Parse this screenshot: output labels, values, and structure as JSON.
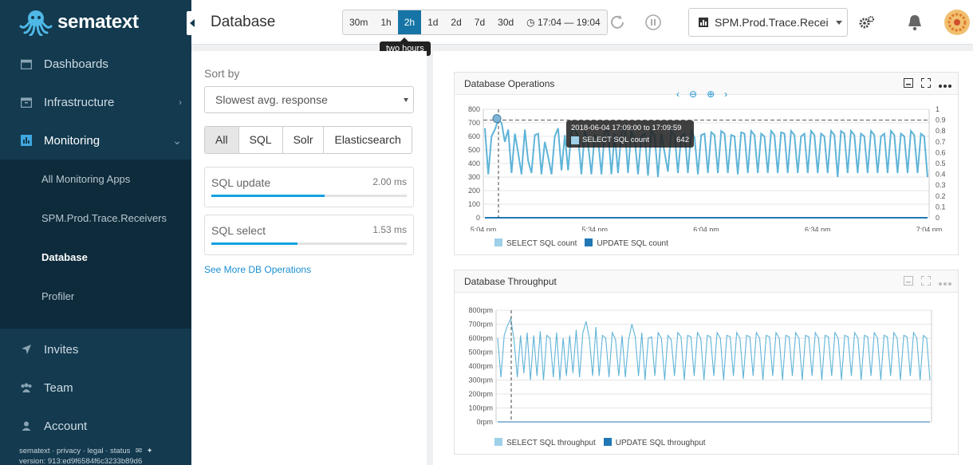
{
  "brand": {
    "name": "sematext"
  },
  "sidebar": {
    "items": [
      {
        "label": "Dashboards",
        "icon": "calendar-icon"
      },
      {
        "label": "Infrastructure",
        "icon": "box-icon"
      },
      {
        "label": "Monitoring",
        "icon": "chart-icon"
      }
    ],
    "monitoring_sub": [
      {
        "label": "All Monitoring Apps"
      },
      {
        "label": "SPM.Prod.Trace.Receivers"
      },
      {
        "label": "Database"
      },
      {
        "label": "Profiler"
      }
    ],
    "bottom_items": [
      {
        "label": "Invites",
        "icon": "send-icon"
      },
      {
        "label": "Team",
        "icon": "team-icon"
      },
      {
        "label": "Account",
        "icon": "user-icon"
      }
    ],
    "footer_links": "sematext · privacy · legal · status",
    "version": "version: 913:ed9f6584f6c3233b89d6"
  },
  "header": {
    "title": "Database",
    "time_buttons": [
      "30m",
      "1h",
      "2h",
      "1d",
      "2d",
      "7d",
      "30d"
    ],
    "time_selected": "2h",
    "time_range": "17:04 — 19:04",
    "tooltip": "two hours",
    "app_selector": "SPM.Prod.Trace.Recei"
  },
  "left": {
    "sort_label": "Sort by",
    "sort_value": "Slowest avg. response",
    "filters": [
      "All",
      "SQL",
      "Solr",
      "Elasticsearch"
    ],
    "filter_selected": "All",
    "operations": [
      {
        "name": "SQL update",
        "value": "2.00 ms",
        "fraction": 0.58
      },
      {
        "name": "SQL select",
        "value": "1.53 ms",
        "fraction": 0.44
      }
    ],
    "see_more": "See More DB Operations"
  },
  "charts": {
    "ops": {
      "title": "Database Operations",
      "tooltip_title": "2018-06-04 17:09:00 to 17:09:59",
      "tooltip_series": "SELECT SQL count",
      "tooltip_value": "642",
      "legend": [
        "SELECT SQL count",
        "UPDATE SQL count"
      ]
    },
    "throughput": {
      "title": "Database Throughput",
      "legend": [
        "SELECT SQL throughput",
        "UPDATE SQL throughput"
      ]
    }
  },
  "colors": {
    "sidebar": "#133a4f",
    "accent": "#1675a6",
    "series1": "#5fb4d8",
    "series2": "#1f77b4"
  },
  "chart_data": [
    {
      "type": "line",
      "title": "Database Operations",
      "x_ticks": [
        "5:04 pm",
        "5:34 pm",
        "6:04 pm",
        "6:34 pm",
        "7:04 pm"
      ],
      "y_ticks": [
        "0",
        "100",
        "200",
        "300",
        "400",
        "500",
        "600",
        "700",
        "800"
      ],
      "y2_ticks": [
        "0",
        "0.1",
        "0.2",
        "0.3",
        "0.4",
        "0.5",
        "0.6",
        "0.7",
        "0.8",
        "0.9",
        "1"
      ],
      "ylim": [
        0,
        800
      ],
      "y2lim": [
        0,
        1
      ],
      "series": [
        {
          "name": "SELECT SQL count",
          "values": [
            660,
            320,
            600,
            650,
            720,
            700,
            560,
            650,
            330,
            620,
            480,
            320,
            650,
            420,
            330,
            610,
            620,
            320,
            560,
            450,
            320,
            600,
            660,
            350,
            610,
            350,
            640,
            650,
            600,
            320,
            640,
            540,
            320,
            610,
            580,
            320,
            630,
            640,
            320,
            620,
            330,
            620,
            680,
            330,
            640,
            580,
            320,
            600,
            620,
            310,
            640,
            610,
            300,
            620,
            480,
            340,
            640,
            610,
            330,
            600,
            620,
            330,
            640,
            590,
            320,
            610,
            620,
            330,
            630,
            610,
            330,
            640,
            620,
            330,
            610,
            600,
            320,
            630,
            620,
            330,
            640,
            610,
            330,
            620,
            600,
            330,
            640,
            610,
            330,
            630,
            620,
            330,
            640,
            610,
            330,
            600,
            620,
            330,
            640,
            610,
            330,
            620,
            600,
            330,
            640,
            610,
            300,
            640,
            620,
            330,
            640,
            610,
            330,
            620,
            600,
            330,
            640,
            610,
            330,
            600,
            620,
            330,
            640,
            610,
            330,
            620,
            600,
            330,
            640,
            610,
            330,
            620,
            600,
            300
          ]
        },
        {
          "name": "UPDATE SQL count",
          "values": [
            0,
            0,
            0,
            0,
            0,
            0,
            0,
            0,
            0,
            0,
            0,
            0,
            0,
            0,
            0,
            0,
            0,
            0,
            0,
            0,
            0,
            0,
            0,
            0,
            0,
            0,
            0,
            0,
            0,
            0,
            0,
            0,
            0,
            0,
            0,
            0,
            0,
            0,
            0,
            0,
            0,
            0,
            0,
            0,
            0,
            0,
            0,
            0,
            0,
            0,
            0,
            0,
            0,
            0,
            0,
            0,
            0,
            0,
            0,
            0,
            0,
            0,
            0,
            0,
            0,
            0,
            0,
            0,
            0,
            0,
            0,
            0,
            0,
            0,
            0,
            0,
            0,
            0,
            0,
            0,
            0,
            0,
            0,
            0,
            0,
            0,
            0,
            0,
            0,
            0,
            0,
            0,
            0,
            0,
            0,
            0,
            0,
            0,
            0,
            0,
            0,
            0,
            0,
            0,
            0,
            0,
            0,
            0,
            0,
            0,
            0,
            0,
            0,
            0,
            0,
            0,
            0,
            0,
            0,
            0,
            0,
            0,
            0,
            0,
            0,
            0,
            0,
            0,
            0,
            0,
            0,
            0,
            0,
            0
          ]
        }
      ],
      "threshold": 720,
      "cursor_x": "5:09 pm",
      "cursor_y": 720
    },
    {
      "type": "line",
      "title": "Database Throughput",
      "x_ticks": [
        "5:04 pm",
        "5:34 pm",
        "6:04 pm",
        "6:34 pm",
        "7:04 pm"
      ],
      "y_ticks": [
        "0rpm",
        "100rpm",
        "200rpm",
        "300rpm",
        "400rpm",
        "500rpm",
        "600rpm",
        "700rpm",
        "800rpm"
      ],
      "ylim": [
        0,
        800
      ],
      "series": [
        {
          "name": "SELECT SQL throughput",
          "values": [
            600,
            320,
            620,
            690,
            740,
            590,
            320,
            620,
            350,
            640,
            300,
            620,
            330,
            650,
            300,
            620,
            600,
            320,
            640,
            300,
            600,
            330,
            620,
            350,
            660,
            320,
            640,
            720,
            600,
            330,
            680,
            330,
            620,
            600,
            320,
            640,
            590,
            330,
            620,
            320,
            590,
            700,
            610,
            330,
            640,
            300,
            600,
            610,
            330,
            640,
            600,
            300,
            620,
            590,
            330,
            640,
            610,
            300,
            620,
            610,
            330,
            640,
            600,
            300,
            620,
            610,
            330,
            640,
            600,
            300,
            620,
            610,
            330,
            640,
            600,
            310,
            620,
            610,
            330,
            640,
            600,
            300,
            620,
            610,
            330,
            640,
            600,
            300,
            620,
            610,
            330,
            640,
            600,
            300,
            620,
            610,
            330,
            640,
            600,
            300,
            620,
            610,
            330,
            640,
            600,
            300,
            620,
            610,
            330,
            640,
            600,
            300,
            620,
            610,
            330,
            640,
            600,
            300,
            620,
            610,
            330,
            640,
            600,
            300,
            620,
            610,
            330,
            640,
            600,
            300,
            620,
            600,
            300
          ]
        },
        {
          "name": "UPDATE SQL throughput",
          "values": [
            0,
            0,
            0,
            0,
            0,
            0,
            0,
            0,
            0,
            0,
            0,
            0,
            0,
            0,
            0,
            0,
            0,
            0,
            0,
            0,
            0,
            0,
            0,
            0,
            0,
            0,
            0,
            0,
            0,
            0,
            0,
            0,
            0,
            0,
            0,
            0,
            0,
            0,
            0,
            0,
            0,
            0,
            0,
            0,
            0,
            0,
            0,
            0,
            0,
            0,
            0,
            0,
            0,
            0,
            0,
            0,
            0,
            0,
            0,
            0,
            0,
            0,
            0,
            0,
            0,
            0,
            0,
            0,
            0,
            0,
            0,
            0,
            0,
            0,
            0,
            0,
            0,
            0,
            0,
            0,
            0,
            0,
            0,
            0,
            0,
            0,
            0,
            0,
            0,
            0,
            0,
            0,
            0,
            0,
            0,
            0,
            0,
            0,
            0,
            0,
            0,
            0,
            0,
            0,
            0,
            0,
            0,
            0,
            0,
            0,
            0,
            0,
            0,
            0,
            0,
            0,
            0,
            0,
            0,
            0,
            0,
            0,
            0,
            0,
            0,
            0,
            0,
            0,
            0,
            0,
            0,
            0,
            0,
            0
          ]
        }
      ],
      "cursor_x": "5:09 pm"
    }
  ]
}
